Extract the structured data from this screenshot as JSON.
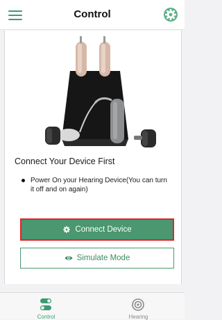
{
  "header": {
    "title": "Control",
    "menu_icon": "hamburger-menu-icon",
    "settings_icon": "settings-gear-icon"
  },
  "main": {
    "heading": "Connect Your Device First",
    "instructions": [
      "Power On your Hearing Device(You can turn it off and on again)"
    ],
    "connect_button_label": "Connect Device",
    "simulate_button_label": "Simulate Mode"
  },
  "tabbar": {
    "tabs": [
      {
        "label": "Control",
        "icon": "toggle-sliders-icon",
        "active": true
      },
      {
        "label": "Hearing",
        "icon": "ear-icon",
        "active": false
      }
    ]
  },
  "colors": {
    "accent": "#4a9770",
    "highlight_border": "#e0242a"
  }
}
